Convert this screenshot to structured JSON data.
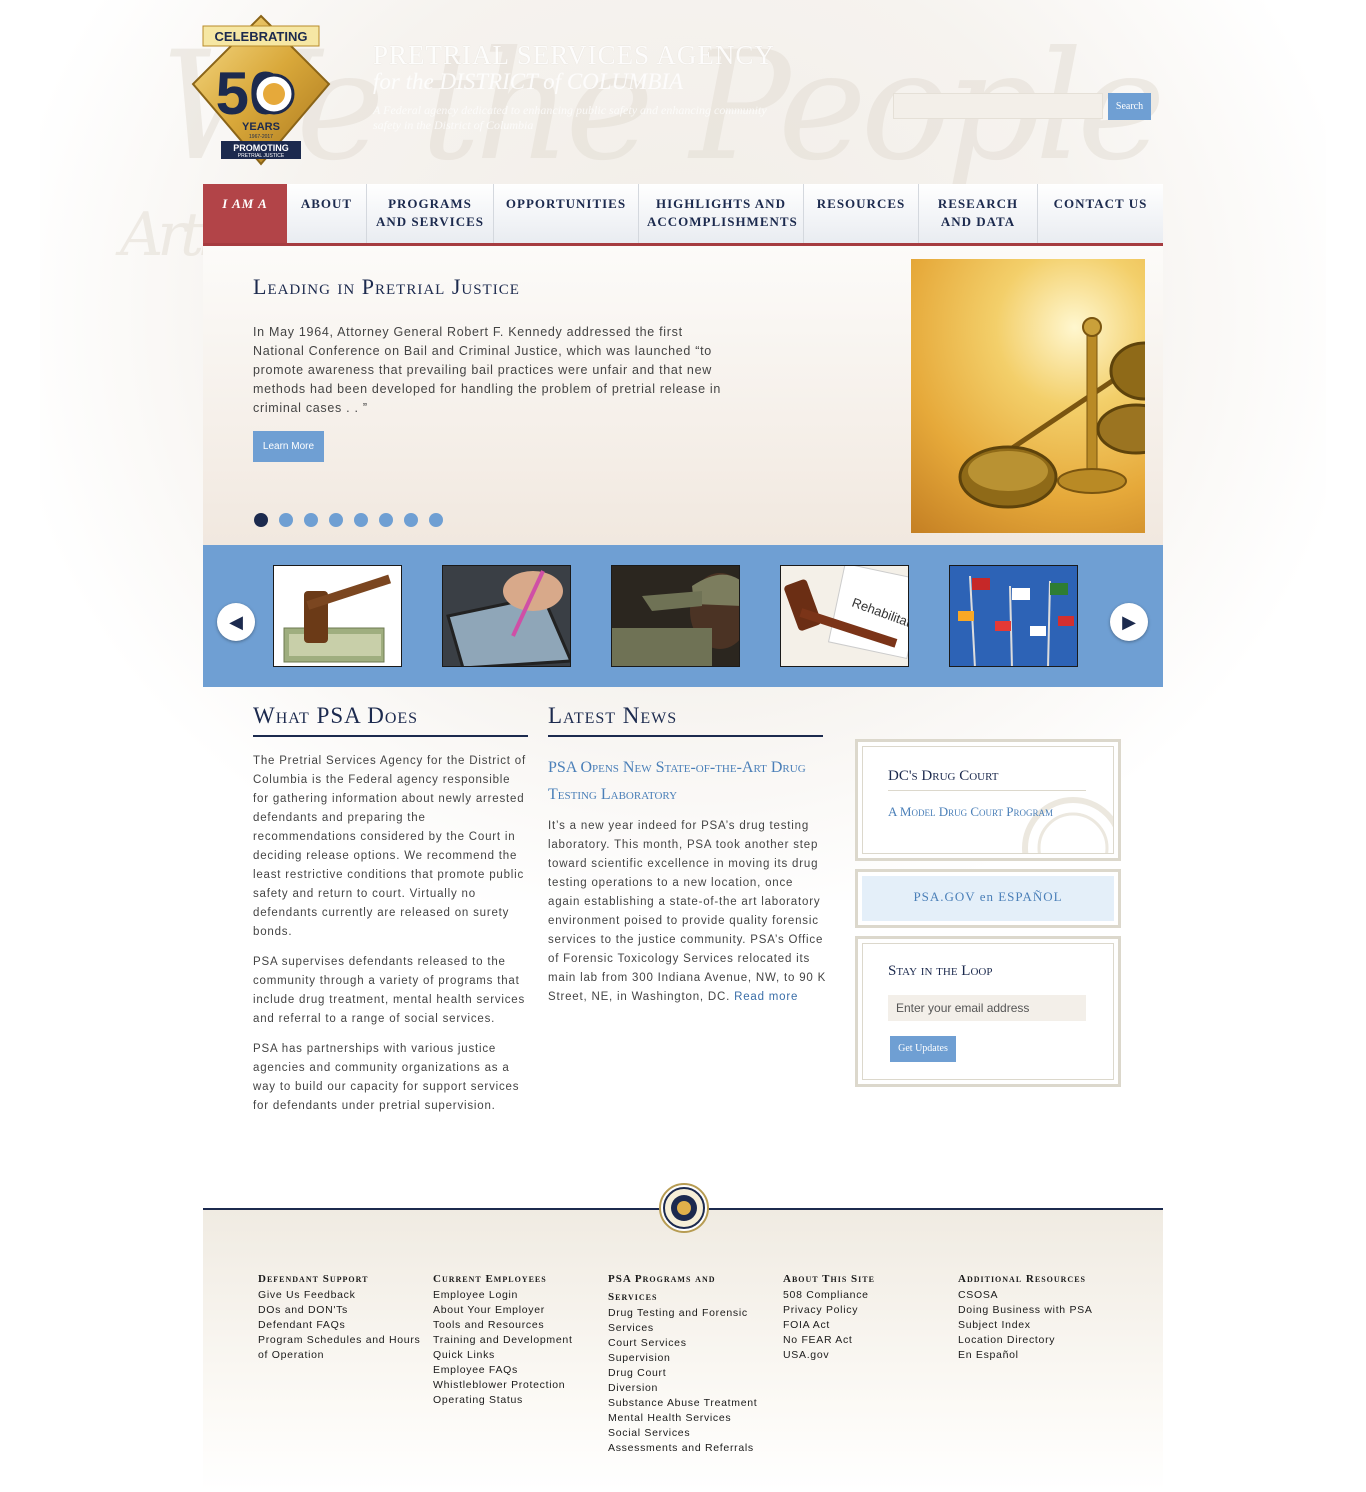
{
  "header": {
    "logo": {
      "top_text": "CELEBRATING",
      "number": "50",
      "years": "YEARS",
      "dates": "1967-2017",
      "bottom_text": "PROMOTING",
      "bottom_sub": "PRETRIAL JUSTICE"
    },
    "agency_line1": "PRETRIAL SERVICES AGENCY",
    "agency_line2": "for the DISTRICT of COLUMBIA",
    "tagline": "A Federal agency dedicated to enhancing public safety and enhancing community safety in the District of Columbia",
    "search": {
      "placeholder": "",
      "button": "Search"
    }
  },
  "nav": [
    {
      "label": "I AM A"
    },
    {
      "label": "ABOUT"
    },
    {
      "label": "PROGRAMS AND SERVICES"
    },
    {
      "label": "OPPORTUNITIES"
    },
    {
      "label": "HIGHLIGHTS AND ACCOMPLISHMENTS"
    },
    {
      "label": "RESOURCES"
    },
    {
      "label": "RESEARCH AND DATA"
    },
    {
      "label": "CONTACT US"
    }
  ],
  "hero": {
    "title": "Leading in Pretrial Justice",
    "text": "In May 1964, Attorney General Robert F. Kennedy addressed the first National Conference on Bail and Criminal Justice, which was launched “to promote awareness that prevailing bail practices were unfair and that new methods had been developed for handling the problem of pretrial release in criminal cases .  . ”",
    "button": "Learn More",
    "slide_count": 8,
    "active_slide": 1,
    "image_icon": "scales-of-justice"
  },
  "carousel": {
    "prev_icon": "arrow-left-icon",
    "next_icon": "arrow-right-icon",
    "thumbs": [
      {
        "icon": "gavel-on-money"
      },
      {
        "icon": "tablet-with-stylus"
      },
      {
        "icon": "saluting-soldier"
      },
      {
        "icon": "gavel-rehabilitation",
        "text": "Rehabilitati"
      },
      {
        "icon": "international-flags"
      }
    ]
  },
  "what_psa_does": {
    "title": "What PSA Does",
    "paragraphs": [
      "The Pretrial Services Agency for the District of Columbia is the Federal agency responsible for gathering information about newly arrested defendants and preparing the recommendations considered by the Court in deciding release options. We recommend the least restrictive conditions that promote public safety and return to court. Virtually no defendants currently are released on surety bonds.",
      "PSA supervises defendants released to the community through a variety of programs that include drug treatment, mental health services and referral to a range of social services.",
      "PSA has partnerships with various justice agencies and community organizations as a way to build our capacity for support services for defendants under pretrial supervision."
    ]
  },
  "latest_news": {
    "title": "Latest News",
    "headline": "PSA Opens New State-of-the-Art Drug Testing Laboratory",
    "body": "It’s a new year indeed for PSA’s drug testing laboratory. This month, PSA took another step toward scientific excellence in moving its drug testing operations to a new location, once again establishing a state-of-the art laboratory environment poised to provide quality forensic services to the justice community. PSA’s Office of Forensic Toxicology Services relocated its main lab from 300 Indiana Avenue, NW, to 90 K Street, NE, in Washington, DC.",
    "read_more": "Read more"
  },
  "sidebar": {
    "drug_court": {
      "title": "DC's Drug Court",
      "link": "A Model Drug Court Program"
    },
    "espanol": "PSA.GOV en ESPAÑOL",
    "loop": {
      "title": "Stay in the Loop",
      "placeholder": "Enter your email address",
      "button": "Get Updates"
    }
  },
  "footer": {
    "columns": [
      {
        "heading": "Defendant Support",
        "items": [
          "Give Us Feedback",
          "DOs and DON'Ts",
          "Defendant FAQs",
          "Program Schedules and Hours of Operation"
        ]
      },
      {
        "heading": "Current Employees",
        "items": [
          "Employee Login",
          "About Your Employer",
          "Tools and Resources",
          "Training and Development",
          "Quick Links",
          "Employee FAQs",
          "Whistleblower Protection",
          "Operating Status"
        ]
      },
      {
        "heading": "PSA Programs and Services",
        "items": [
          "Drug Testing and Forensic Services",
          "Court Services",
          "Supervision",
          "Drug Court",
          "Diversion",
          "Substance Abuse Treatment",
          "Mental Health Services",
          "Social Services",
          "Assessments and Referrals"
        ]
      },
      {
        "heading": "About This Site",
        "items": [
          "508 Compliance",
          "Privacy Policy",
          "FOIA Act",
          "No FEAR Act",
          "USA.gov"
        ]
      },
      {
        "heading": "Additional Resources",
        "items": [
          "CSOSA",
          "Doing Business with PSA",
          "Subject Index",
          "Location Directory",
          "En Español"
        ]
      }
    ]
  },
  "colors": {
    "navy": "#1c2a4e",
    "accent_blue": "#6f9fd3",
    "nav_red": "#b24448",
    "link_blue": "#4a7fb8"
  }
}
